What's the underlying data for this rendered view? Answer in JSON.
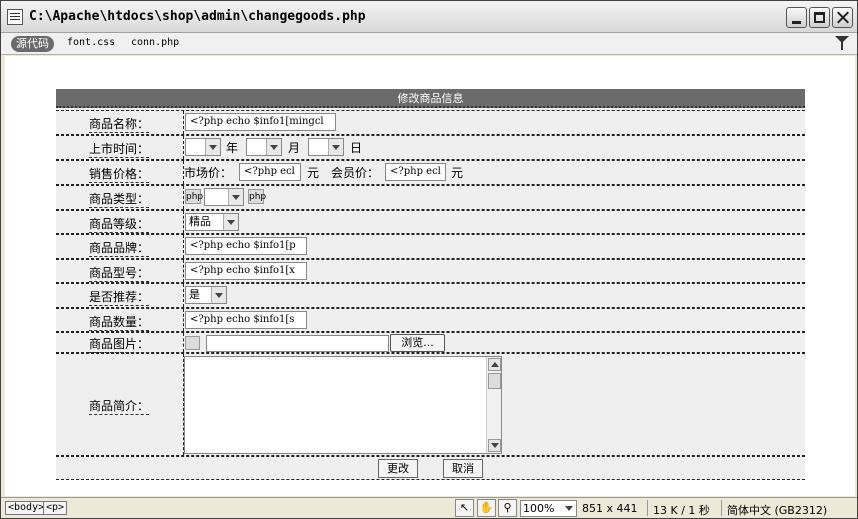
{
  "window": {
    "title": "C:\\Apache\\htdocs\\shop\\admin\\changegoods.php"
  },
  "toolbar": {
    "source_label": "源代码",
    "related_files": [
      "font.css",
      "conn.php"
    ]
  },
  "form": {
    "header": "修改商品信息",
    "rows": {
      "name": {
        "label": "商品名称：",
        "php": "<?php echo $info1[mingcl"
      },
      "date": {
        "label": "上市时间：",
        "year": "年",
        "month": "月",
        "day": "日"
      },
      "price": {
        "label": "销售价格：",
        "market_label": "市场价：",
        "market_php": "<?php ecl",
        "unit1": "元",
        "member_label": "会员价：",
        "member_php": "<?php ecl",
        "unit2": "元"
      },
      "type": {
        "label": "商品类型：",
        "php_icon_left": "php",
        "php_icon_right": "php"
      },
      "grade": {
        "label": "商品等级：",
        "selected": "精品"
      },
      "brand": {
        "label": "商品品牌：",
        "php": "<?php echo $info1[p"
      },
      "model": {
        "label": "商品型号：",
        "php": "<?php echo $info1[x"
      },
      "recommend": {
        "label": "是否推荐：",
        "selected": "是"
      },
      "quantity": {
        "label": "商品数量：",
        "php": "<?php echo $info1[s"
      },
      "image": {
        "label": "商品图片：",
        "browse": "浏览..."
      },
      "intro": {
        "label": "商品简介："
      }
    },
    "buttons": {
      "submit": "更改",
      "cancel": "取消"
    }
  },
  "statusbar": {
    "tag_body": "<body>",
    "tag_p": "<p>",
    "zoom": "100%",
    "dimensions": "851 x 441",
    "size_time": "13 K / 1 秒",
    "encoding": "简体中文 (GB2312)"
  }
}
